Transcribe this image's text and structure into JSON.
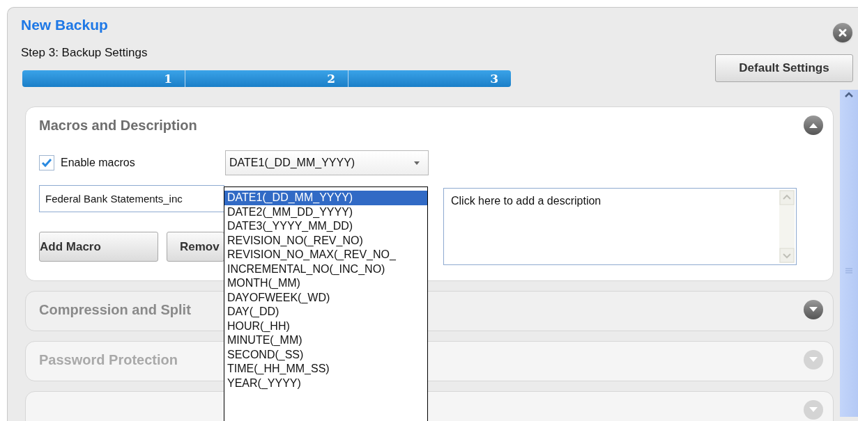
{
  "window": {
    "title": "New Backup",
    "subtitle": "Step 3: Backup Settings"
  },
  "progress": {
    "steps": [
      "1",
      "2",
      "3"
    ]
  },
  "default_button": "Default Settings",
  "sections": [
    {
      "title": "Macros and Description",
      "expanded": true,
      "disabled": false
    },
    {
      "title": "Compression and Split",
      "expanded": false,
      "disabled": false
    },
    {
      "title": "Password Protection",
      "expanded": false,
      "disabled": true
    },
    {
      "expanded": false,
      "disabled": true
    }
  ],
  "macros": {
    "enable": {
      "label": "Enable macros",
      "checked": true
    },
    "select": {
      "value": "DATE1(_DD_MM_YYYY)",
      "expanded": true,
      "options": [
        {
          "label": "DATE1(_DD_MM_YYYY)",
          "selected": true
        },
        {
          "label": "DATE2(_MM_DD_YYYY)",
          "selected": false
        },
        {
          "label": "DATE3(_YYYY_MM_DD)",
          "selected": false
        },
        {
          "label": "REVISION_NO(_REV_NO)",
          "selected": false
        },
        {
          "label": "REVISION_NO_MAX(_REV_NO_",
          "selected": false
        },
        {
          "label": "INCREMENTAL_NO(_INC_NO)",
          "selected": false
        },
        {
          "label": "MONTH(_MM)",
          "selected": false
        },
        {
          "label": "DAYOFWEEK(_WD)",
          "selected": false
        },
        {
          "label": "DAY(_DD)",
          "selected": false
        },
        {
          "label": "HOUR(_HH)",
          "selected": false
        },
        {
          "label": "MINUTE(_MM)",
          "selected": false
        },
        {
          "label": "SECOND(_SS)",
          "selected": false
        },
        {
          "label": "TIME(_HH_MM_SS)",
          "selected": false
        },
        {
          "label": "YEAR(_YYYY)",
          "selected": false
        }
      ]
    },
    "name_field": {
      "value": "Federal Bank Statements_inc"
    },
    "buttons": [
      "Add Macro",
      "Remov"
    ],
    "description": {
      "placeholder": "Click here to add a description"
    }
  }
}
